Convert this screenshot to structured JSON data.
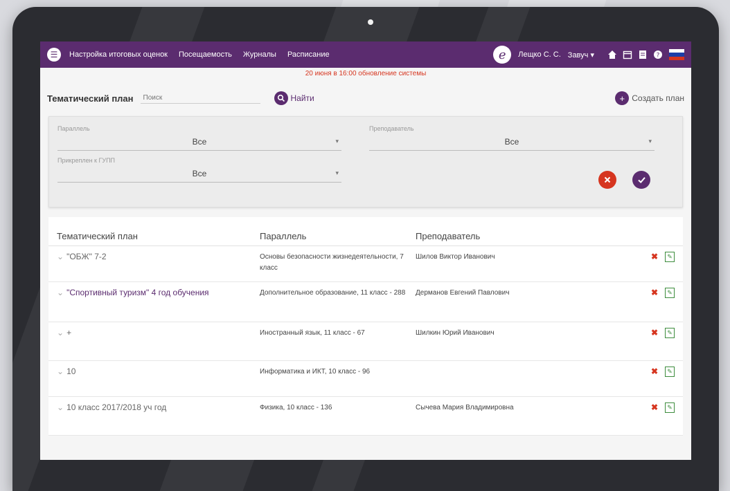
{
  "nav": {
    "links": [
      "Настройка итоговых оценок",
      "Посещаемость",
      "Журналы",
      "Расписание"
    ],
    "logo_letter": "e",
    "user": "Лещко С. С.",
    "role": "Завуч",
    "role_caret": "▾",
    "icons": [
      "home-icon",
      "calendar-icon",
      "document-icon",
      "help-icon"
    ],
    "flag_colors": [
      "#ffffff",
      "#1c3ea8",
      "#d6351f"
    ]
  },
  "notice": "20 июня в 16:00 обновление системы",
  "toolbar": {
    "title": "Тематический план",
    "search_placeholder": "Поиск",
    "find_label": "Найти",
    "create_label": "Создать план"
  },
  "filters": {
    "parallel_label": "Параллель",
    "parallel_value": "Все",
    "teacher_label": "Преподаватель",
    "teacher_value": "Все",
    "attached_label": "Прикреплен к ГУПП",
    "attached_value": "Все",
    "caret": "▾"
  },
  "table": {
    "headers": [
      "Тематический план",
      "Параллель",
      "Преподаватель"
    ],
    "rows": [
      {
        "plan": "\"ОБЖ\" 7-2",
        "parallel": "Основы безопасности жизнедеятельности, 7 класс",
        "teacher": "Шилов Виктор Иванович"
      },
      {
        "plan": "\"Спортивный туризм\" 4 год обучения",
        "parallel": "Дополнительное образование, 11 класс - 288",
        "teacher": "Дерманов Евгений Павлович"
      },
      {
        "plan": "+",
        "parallel": "Иностранный язык, 11 класс - 67",
        "teacher": "Шилкин Юрий Иванович"
      },
      {
        "plan": "10",
        "parallel": "Информатика и ИКТ, 10 класс - 96",
        "teacher": ""
      },
      {
        "plan": "10 класс 2017/2018 уч год",
        "parallel": "Физика, 10 класс - 136",
        "teacher": "Сычева Мария Владимировна"
      }
    ],
    "delete_icon": "✖",
    "edit_icon": "✎"
  },
  "colors": {
    "accent": "#5b2c6f",
    "danger": "#d6351f",
    "edit": "#3c8c3c"
  }
}
